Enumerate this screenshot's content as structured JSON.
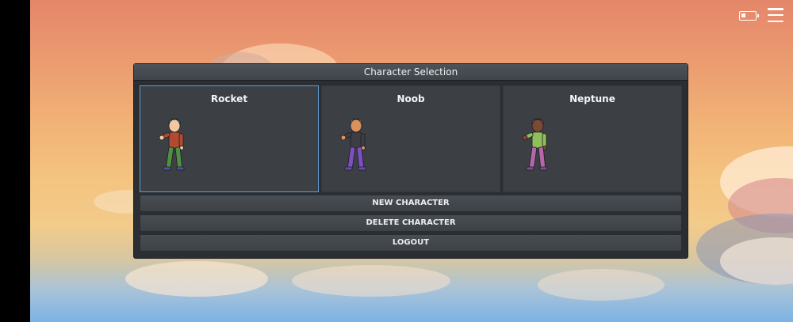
{
  "panel": {
    "title": "Character Selection"
  },
  "characters": [
    {
      "name": "Rocket",
      "selected": true,
      "colors": {
        "hair": "#3aa17a",
        "skin": "#f0c9a2",
        "shirt": "#b24a30",
        "pants": "#4f8f43",
        "shoes": "#5b4ba6"
      }
    },
    {
      "name": "Noob",
      "selected": false,
      "colors": {
        "hair": "#d08a5a",
        "skin": "#d9925e",
        "shirt": "#3d3d44",
        "pants": "#7d4fc2",
        "shoes": "#6a4cae"
      }
    },
    {
      "name": "Neptune",
      "selected": false,
      "colors": {
        "hair": "#b44a8a",
        "skin": "#7a4a32",
        "shirt": "#8fbf5a",
        "pants": "#b567a8",
        "shoes": "#7a4f8f"
      }
    }
  ],
  "buttons": {
    "new_character": "NEW CHARACTER",
    "delete_character": "DELETE CHARACTER",
    "logout": "LOGOUT"
  },
  "icons": [
    "battery-icon",
    "menu-icon"
  ],
  "accent_color": "#5f9dd3"
}
